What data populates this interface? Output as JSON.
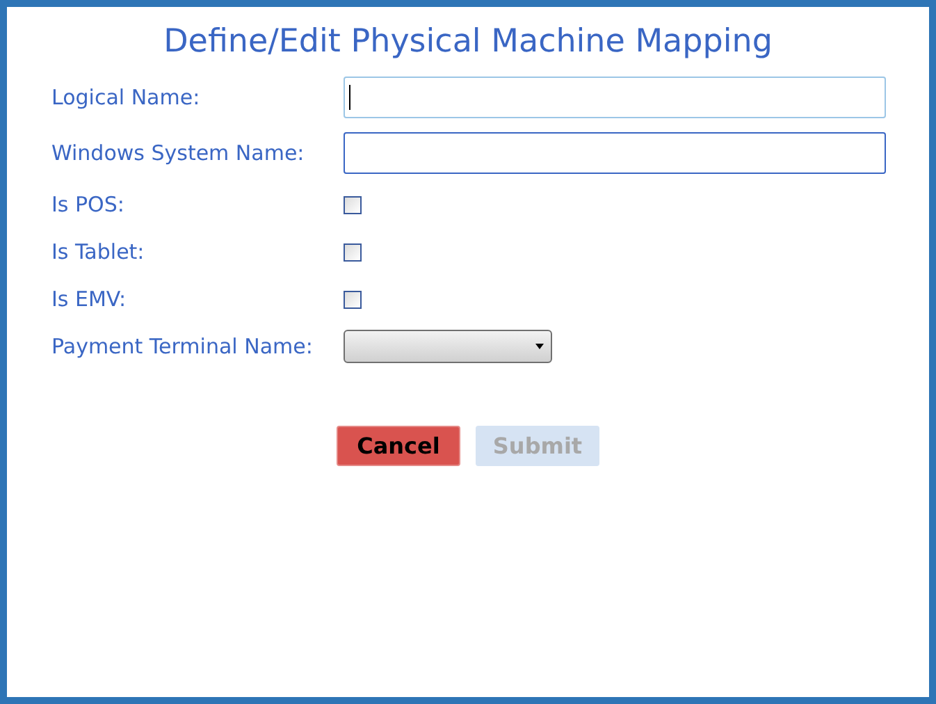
{
  "title": "Define/Edit Physical Machine Mapping",
  "fields": [
    {
      "kind": "text",
      "label": "Logical Name:",
      "focused": true
    },
    {
      "kind": "text",
      "label": "Windows System Name:",
      "focused": false
    },
    {
      "kind": "checkbox",
      "label": "Is POS:",
      "checked": false
    },
    {
      "kind": "checkbox",
      "label": "Is Tablet:",
      "checked": false
    },
    {
      "kind": "checkbox",
      "label": "Is EMV:",
      "checked": false
    },
    {
      "kind": "select",
      "label": "Payment Terminal Name:"
    }
  ],
  "buttons": [
    {
      "kind": "cancel",
      "label": "Cancel",
      "disabled": false
    },
    {
      "kind": "submit",
      "label": "Submit",
      "disabled": true
    }
  ]
}
